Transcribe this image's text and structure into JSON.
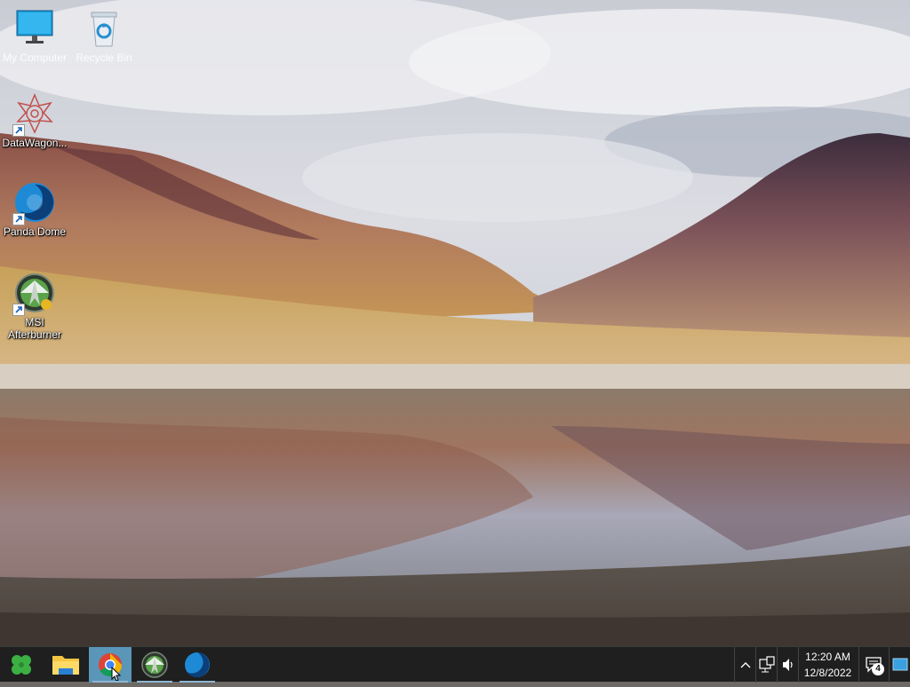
{
  "desktop": {
    "icons": [
      {
        "id": "my-computer",
        "label": "My Computer"
      },
      {
        "id": "recycle-bin",
        "label": "Recycle Bin"
      },
      {
        "id": "datawagon",
        "label": "DataWagon..."
      },
      {
        "id": "panda-dome",
        "label": "Panda Dome"
      },
      {
        "id": "msi-afterburner",
        "label": "MSI Afterburner"
      }
    ]
  },
  "taskbar": {
    "start_icon": "clover-start-icon",
    "apps": [
      {
        "name": "File Explorer",
        "icon": "folder-icon"
      },
      {
        "name": "Google Chrome",
        "icon": "chrome-icon",
        "active": true
      },
      {
        "name": "MSI Afterburner",
        "icon": "afterburner-icon"
      },
      {
        "name": "Panda Dome",
        "icon": "panda-dome-icon"
      }
    ],
    "tray": {
      "time": "12:20 AM",
      "date": "12/8/2022",
      "notification_count": "4"
    }
  },
  "colors": {
    "taskbar": "#1f1f1f",
    "active_app": "#5a96b8",
    "notification": "#ffffff"
  }
}
